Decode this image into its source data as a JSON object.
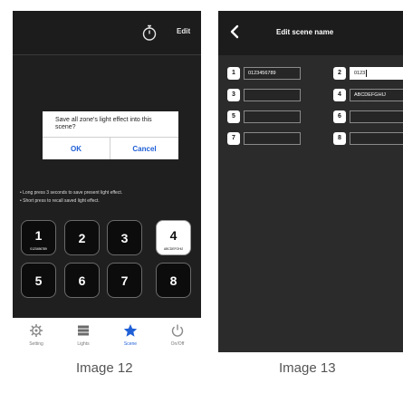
{
  "left": {
    "edit_label": "Edit",
    "dialog": {
      "message": "Save all zone's light effect into this scene?",
      "ok_label": "OK",
      "cancel_label": "Cancel"
    },
    "hints": [
      "• Long press 3 seconds to save present light effect.",
      "• Short press to recall saved light effect."
    ],
    "scenes": [
      {
        "number": "1",
        "name": "0123456789"
      },
      {
        "number": "2",
        "name": ""
      },
      {
        "number": "3",
        "name": ""
      },
      {
        "number": "4",
        "name": "ABCDEFGHIJ"
      },
      {
        "number": "5",
        "name": ""
      },
      {
        "number": "6",
        "name": ""
      },
      {
        "number": "7",
        "name": ""
      },
      {
        "number": "8",
        "name": ""
      }
    ],
    "tabs": [
      {
        "label": "Setting",
        "icon": "gear-icon"
      },
      {
        "label": "Lights",
        "icon": "grid-icon"
      },
      {
        "label": "Scene",
        "icon": "star-icon"
      },
      {
        "label": "On/Off",
        "icon": "power-icon"
      }
    ],
    "caption": "Image 12"
  },
  "right": {
    "title": "Edit scene name",
    "fields": [
      {
        "number": "1",
        "value": "0123456789"
      },
      {
        "number": "2",
        "value": "0123"
      },
      {
        "number": "3",
        "value": ""
      },
      {
        "number": "4",
        "value": "ABCDEFGHIJ"
      },
      {
        "number": "5",
        "value": ""
      },
      {
        "number": "6",
        "value": ""
      },
      {
        "number": "7",
        "value": ""
      },
      {
        "number": "8",
        "value": ""
      }
    ],
    "caption": "Image 13"
  },
  "colors": {
    "accent": "#1f5fd6",
    "panel_dark": "#1f1f1f",
    "panel_right": "#2b2b2b"
  }
}
